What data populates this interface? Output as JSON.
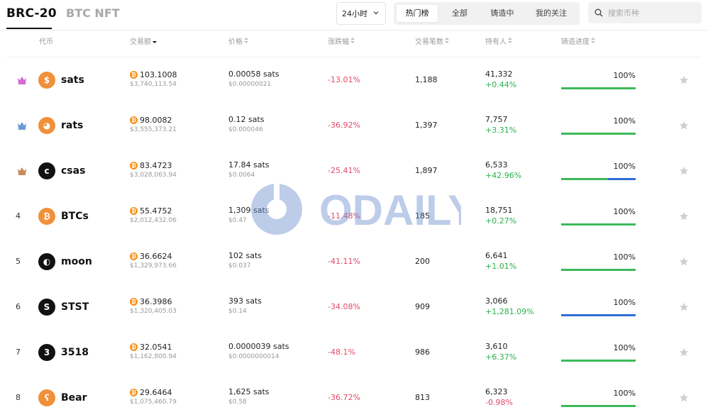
{
  "tabs": {
    "brc20": "BRC-20",
    "btc_nft": "BTC NFT"
  },
  "period": {
    "value": "24小时"
  },
  "filters": [
    {
      "label": "热门榜",
      "active": true
    },
    {
      "label": "全部",
      "active": false
    },
    {
      "label": "铸造中",
      "active": false
    },
    {
      "label": "我的关注",
      "active": false
    }
  ],
  "search": {
    "placeholder": "搜索币种"
  },
  "columns": {
    "token": "代币",
    "volume": "交易额",
    "price": "价格",
    "change": "涨跌幅",
    "trades": "交易笔数",
    "holders": "持有人",
    "mint_progress": "铸造进度"
  },
  "watermark": "ODAILY",
  "rows": [
    {
      "rank": "1",
      "name": "sats",
      "icon": "sats-coin-icon",
      "volume_btc": "103.1008",
      "volume_usd": "$3,740,113.54",
      "price_sats": "0.00058 sats",
      "price_usd": "$0.00000021",
      "change": "-13.01%",
      "trades": "1,188",
      "holders": "41,332",
      "holders_change": "+0.44%",
      "progress": "100%",
      "progress_color": "#3cb95a"
    },
    {
      "rank": "2",
      "name": "rats",
      "icon": "rats-coin-icon",
      "volume_btc": "98.0082",
      "volume_usd": "$3,555,373.21",
      "price_sats": "0.12 sats",
      "price_usd": "$0.000046",
      "change": "-36.92%",
      "trades": "1,397",
      "holders": "7,757",
      "holders_change": "+3.31%",
      "progress": "100%",
      "progress_color": "#3cb95a"
    },
    {
      "rank": "3",
      "name": "csas",
      "icon": "csas-coin-icon",
      "volume_btc": "83.4723",
      "volume_usd": "$3,028,063.94",
      "price_sats": "17.84 sats",
      "price_usd": "$0.0064",
      "change": "-25.41%",
      "trades": "1,897",
      "holders": "6,533",
      "holders_change": "+42.96%",
      "progress": "100%",
      "progress_color": "#3cb95a",
      "progress_tail": "#2f6fd6"
    },
    {
      "rank": "4",
      "name": "BTCs",
      "icon": "btcs-coin-icon",
      "volume_btc": "55.4752",
      "volume_usd": "$2,012,432.06",
      "price_sats": "1,309 sats",
      "price_usd": "$0.47",
      "change": "-11.48%",
      "trades": "185",
      "holders": "18,751",
      "holders_change": "+0.27%",
      "progress": "100%",
      "progress_color": "#3cb95a"
    },
    {
      "rank": "5",
      "name": "moon",
      "icon": "moon-coin-icon",
      "volume_btc": "36.6624",
      "volume_usd": "$1,329,973.66",
      "price_sats": "102 sats",
      "price_usd": "$0.037",
      "change": "-41.11%",
      "trades": "200",
      "holders": "6,641",
      "holders_change": "+1.01%",
      "progress": "100%",
      "progress_color": "#3cb95a"
    },
    {
      "rank": "6",
      "name": "STST",
      "icon": "stst-coin-icon",
      "volume_btc": "36.3986",
      "volume_usd": "$1,320,405.03",
      "price_sats": "393 sats",
      "price_usd": "$0.14",
      "change": "-34.08%",
      "trades": "909",
      "holders": "3,066",
      "holders_change": "+1,281.09%",
      "progress": "100%",
      "progress_color": "#2f6fd6"
    },
    {
      "rank": "7",
      "name": "3518",
      "icon": "3518-coin-icon",
      "volume_btc": "32.0541",
      "volume_usd": "$1,162,800.94",
      "price_sats": "0.0000039 sats",
      "price_usd": "$0.0000000014",
      "change": "-48.1%",
      "trades": "986",
      "holders": "3,610",
      "holders_change": "+6.37%",
      "progress": "100%",
      "progress_color": "#3cb95a"
    },
    {
      "rank": "8",
      "name": "Bear",
      "icon": "bear-coin-icon",
      "volume_btc": "29.6464",
      "volume_usd": "$1,075,460.79",
      "price_sats": "1,625 sats",
      "price_usd": "$0.58",
      "change": "-36.72%",
      "trades": "813",
      "holders": "6,323",
      "holders_change": "-0.98%",
      "progress": "100%",
      "progress_color": "#3cb95a"
    }
  ]
}
